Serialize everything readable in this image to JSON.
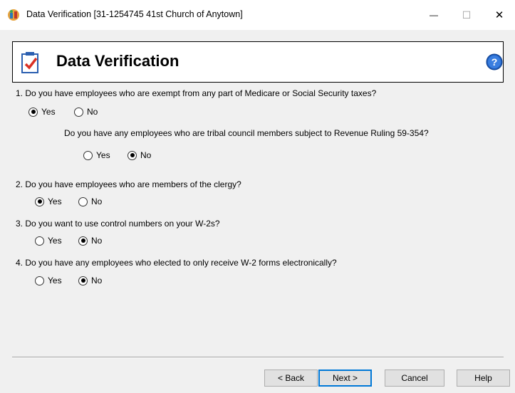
{
  "window": {
    "title": "Data Verification [31-1254745 41st Church of Anytown]",
    "controls": {
      "minimize": "—",
      "maximize": "☐",
      "close": "✕"
    }
  },
  "header": {
    "title": "Data Verification",
    "icon": "checklist-icon",
    "help_icon": "help-icon"
  },
  "questions": [
    {
      "text": "1. Do you have employees who are exempt from any part of Medicare or Social Security taxes?",
      "yes": "Yes",
      "no": "No",
      "selected": "yes",
      "sub": {
        "text": "Do you have any employees who are tribal council members subject to Revenue Ruling 59-354?",
        "yes": "Yes",
        "no": "No",
        "selected": "no"
      }
    },
    {
      "text": "2. Do you have employees who are members of the clergy?",
      "yes": "Yes",
      "no": "No",
      "selected": "yes"
    },
    {
      "text": "3. Do you want to use control numbers on your W-2s?",
      "yes": "Yes",
      "no": "No",
      "selected": "no"
    },
    {
      "text": "4. Do you have any employees who elected to only receive W-2 forms electronically?",
      "yes": "Yes",
      "no": "No",
      "selected": "no"
    }
  ],
  "buttons": {
    "back": "< Back",
    "next": "Next >",
    "cancel": "Cancel",
    "help": "Help"
  },
  "colors": {
    "accent": "#0078d7",
    "dialog_bg": "#f0f0f0",
    "help_blue": "#1f5fbf"
  }
}
